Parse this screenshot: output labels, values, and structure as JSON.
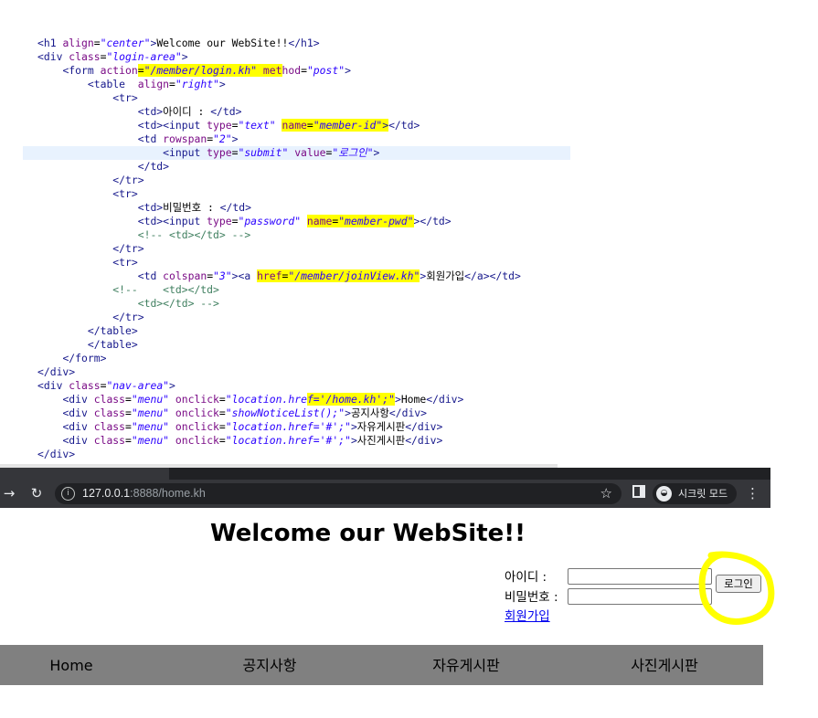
{
  "code": {
    "lines": [
      [
        {
          "c": "tag",
          "t": "<h1 "
        },
        {
          "c": "attr",
          "t": "align"
        },
        {
          "c": "txt",
          "t": "="
        },
        {
          "c": "str",
          "t": "\"center\""
        },
        {
          "c": "tag",
          "t": ">"
        },
        {
          "c": "txt",
          "t": "Welcome our WebSite!!"
        },
        {
          "c": "tag",
          "t": "</h1>"
        }
      ],
      [
        {
          "c": "tag",
          "t": "<div "
        },
        {
          "c": "attr",
          "t": "class"
        },
        {
          "c": "txt",
          "t": "="
        },
        {
          "c": "str",
          "t": "\"login-area\""
        },
        {
          "c": "tag",
          "t": ">"
        }
      ],
      [
        {
          "c": "txt",
          "t": "    "
        },
        {
          "c": "tag",
          "t": "<form "
        },
        {
          "c": "attr",
          "t": "action"
        },
        {
          "c": "txt hl",
          "t": "="
        },
        {
          "c": "str hl",
          "t": "\"/member/login.kh\""
        },
        {
          "c": "txt hl",
          "t": " "
        },
        {
          "c": "attr hl",
          "t": "met"
        },
        {
          "c": "attr",
          "t": "hod"
        },
        {
          "c": "txt",
          "t": "="
        },
        {
          "c": "str",
          "t": "\"post\""
        },
        {
          "c": "tag",
          "t": ">"
        }
      ],
      [
        {
          "c": "txt",
          "t": "        "
        },
        {
          "c": "tag",
          "t": "<table  "
        },
        {
          "c": "attr",
          "t": "align"
        },
        {
          "c": "txt",
          "t": "="
        },
        {
          "c": "str",
          "t": "\"right\""
        },
        {
          "c": "tag",
          "t": ">"
        }
      ],
      [
        {
          "c": "txt",
          "t": "            "
        },
        {
          "c": "tag",
          "t": "<tr>"
        }
      ],
      [
        {
          "c": "txt",
          "t": "                "
        },
        {
          "c": "tag",
          "t": "<td>"
        },
        {
          "c": "txt",
          "t": "아이디 : "
        },
        {
          "c": "tag",
          "t": "</td>"
        }
      ],
      [
        {
          "c": "txt",
          "t": "                "
        },
        {
          "c": "tag",
          "t": "<td><input "
        },
        {
          "c": "attr",
          "t": "type"
        },
        {
          "c": "txt",
          "t": "="
        },
        {
          "c": "str",
          "t": "\"text\" "
        },
        {
          "c": "attr hl",
          "t": "name"
        },
        {
          "c": "txt hl",
          "t": "="
        },
        {
          "c": "str hl",
          "t": "\"member-id\""
        },
        {
          "c": "tag hl",
          "t": ">"
        },
        {
          "c": "tag",
          "t": "</td>"
        }
      ],
      [
        {
          "c": "txt",
          "t": "                "
        },
        {
          "c": "tag",
          "t": "<td "
        },
        {
          "c": "attr",
          "t": "rowspan"
        },
        {
          "c": "txt",
          "t": "="
        },
        {
          "c": "str",
          "t": "\"2\""
        },
        {
          "c": "tag",
          "t": ">"
        }
      ],
      [
        {
          "c": "txt",
          "t": "                    "
        },
        {
          "c": "tag",
          "t": "<input "
        },
        {
          "c": "attr",
          "t": "type"
        },
        {
          "c": "txt",
          "t": "="
        },
        {
          "c": "str",
          "t": "\"submit\" "
        },
        {
          "c": "attr",
          "t": "value"
        },
        {
          "c": "txt",
          "t": "="
        },
        {
          "c": "str",
          "t": "\"로그인\""
        },
        {
          "c": "tag",
          "t": ">"
        }
      ],
      [
        {
          "c": "txt",
          "t": "                "
        },
        {
          "c": "tag",
          "t": "</td>"
        }
      ],
      [
        {
          "c": "txt",
          "t": "            "
        },
        {
          "c": "tag",
          "t": "</tr>"
        }
      ],
      [
        {
          "c": "txt",
          "t": "            "
        },
        {
          "c": "tag",
          "t": "<tr>"
        }
      ],
      [
        {
          "c": "txt",
          "t": "                "
        },
        {
          "c": "tag",
          "t": "<td>"
        },
        {
          "c": "txt",
          "t": "비밀번호 : "
        },
        {
          "c": "tag",
          "t": "</td>"
        }
      ],
      [
        {
          "c": "txt",
          "t": "                "
        },
        {
          "c": "tag",
          "t": "<td><input "
        },
        {
          "c": "attr",
          "t": "type"
        },
        {
          "c": "txt",
          "t": "="
        },
        {
          "c": "str",
          "t": "\"password\" "
        },
        {
          "c": "attr hl",
          "t": "name"
        },
        {
          "c": "txt hl",
          "t": "="
        },
        {
          "c": "str hl",
          "t": "\"member-pwd\""
        },
        {
          "c": "tag",
          "t": "></td>"
        }
      ],
      [
        {
          "c": "txt",
          "t": "                "
        },
        {
          "c": "cmt",
          "t": "<!-- <td></td> -->"
        }
      ],
      [
        {
          "c": "txt",
          "t": "            "
        },
        {
          "c": "tag",
          "t": "</tr>"
        }
      ],
      [
        {
          "c": "txt",
          "t": "            "
        },
        {
          "c": "tag",
          "t": "<tr>"
        }
      ],
      [
        {
          "c": "txt",
          "t": "                "
        },
        {
          "c": "tag",
          "t": "<td "
        },
        {
          "c": "attr",
          "t": "colspan"
        },
        {
          "c": "txt",
          "t": "="
        },
        {
          "c": "str",
          "t": "\"3\""
        },
        {
          "c": "tag",
          "t": "><a "
        },
        {
          "c": "attr hl",
          "t": "href"
        },
        {
          "c": "txt hl",
          "t": "="
        },
        {
          "c": "str hl",
          "t": "\"/member/joinView.kh\""
        },
        {
          "c": "tag",
          "t": ">"
        },
        {
          "c": "txt",
          "t": "회원가입"
        },
        {
          "c": "tag",
          "t": "</a></td>"
        }
      ],
      [
        {
          "c": "txt",
          "t": "            "
        },
        {
          "c": "cmt",
          "t": "<!--    <td></td>"
        }
      ],
      [
        {
          "c": "txt",
          "t": "                "
        },
        {
          "c": "cmt",
          "t": "<td></td> -->"
        }
      ],
      [
        {
          "c": "txt",
          "t": "            "
        },
        {
          "c": "tag",
          "t": "</tr>"
        }
      ],
      [
        {
          "c": "txt",
          "t": "        "
        },
        {
          "c": "tag",
          "t": "</table>"
        }
      ],
      [
        {
          "c": "txt",
          "t": "        "
        },
        {
          "c": "tag",
          "t": "</table>"
        }
      ],
      [
        {
          "c": "txt",
          "t": "    "
        },
        {
          "c": "tag",
          "t": "</form>"
        }
      ],
      [
        {
          "c": "tag",
          "t": "</div>"
        }
      ],
      [
        {
          "c": "tag",
          "t": "<div "
        },
        {
          "c": "attr",
          "t": "class"
        },
        {
          "c": "txt",
          "t": "="
        },
        {
          "c": "str",
          "t": "\"nav-area\""
        },
        {
          "c": "tag",
          "t": ">"
        }
      ],
      [
        {
          "c": "txt",
          "t": "    "
        },
        {
          "c": "tag",
          "t": "<div "
        },
        {
          "c": "attr",
          "t": "class"
        },
        {
          "c": "txt",
          "t": "="
        },
        {
          "c": "str",
          "t": "\"menu\" "
        },
        {
          "c": "attr",
          "t": "onclick"
        },
        {
          "c": "txt",
          "t": "="
        },
        {
          "c": "str",
          "t": "\"location.hre"
        },
        {
          "c": "str hl",
          "t": "f='/home.kh';\""
        },
        {
          "c": "tag",
          "t": ">"
        },
        {
          "c": "txt",
          "t": "Home"
        },
        {
          "c": "tag",
          "t": "</div>"
        }
      ],
      [
        {
          "c": "txt",
          "t": "    "
        },
        {
          "c": "tag",
          "t": "<div "
        },
        {
          "c": "attr",
          "t": "class"
        },
        {
          "c": "txt",
          "t": "="
        },
        {
          "c": "str",
          "t": "\"menu\" "
        },
        {
          "c": "attr",
          "t": "onclick"
        },
        {
          "c": "txt",
          "t": "="
        },
        {
          "c": "str",
          "t": "\"showNoticeList();\""
        },
        {
          "c": "tag",
          "t": ">"
        },
        {
          "c": "txt",
          "t": "공지사항"
        },
        {
          "c": "tag",
          "t": "</div>"
        }
      ],
      [
        {
          "c": "txt",
          "t": "    "
        },
        {
          "c": "tag",
          "t": "<div "
        },
        {
          "c": "attr",
          "t": "class"
        },
        {
          "c": "txt",
          "t": "="
        },
        {
          "c": "str",
          "t": "\"menu\" "
        },
        {
          "c": "attr",
          "t": "onclick"
        },
        {
          "c": "txt",
          "t": "="
        },
        {
          "c": "str",
          "t": "\"location.href='#';\""
        },
        {
          "c": "tag",
          "t": ">"
        },
        {
          "c": "txt",
          "t": "자유게시판"
        },
        {
          "c": "tag",
          "t": "</div>"
        }
      ],
      [
        {
          "c": "txt",
          "t": "    "
        },
        {
          "c": "tag",
          "t": "<div "
        },
        {
          "c": "attr",
          "t": "class"
        },
        {
          "c": "txt",
          "t": "="
        },
        {
          "c": "str",
          "t": "\"menu\" "
        },
        {
          "c": "attr",
          "t": "onclick"
        },
        {
          "c": "txt",
          "t": "="
        },
        {
          "c": "str",
          "t": "\"location.href='#';\""
        },
        {
          "c": "tag",
          "t": ">"
        },
        {
          "c": "txt",
          "t": "사진게시판"
        },
        {
          "c": "tag",
          "t": "</div>"
        }
      ],
      [
        {
          "c": "tag",
          "t": "</div>"
        }
      ]
    ],
    "current_line": 8
  },
  "browser": {
    "url_host": "127.0.0.1",
    "url_rest": ":8888/home.kh",
    "incognito_label": "시크릿 모드"
  },
  "page": {
    "title": "Welcome our WebSite!!",
    "id_label": "아이디 :",
    "pw_label": "비밀번호 :",
    "login_button": "로그인",
    "join_link": "회원가입",
    "menu": [
      "Home",
      "공지사항",
      "자유게시판",
      "사진게시판"
    ]
  },
  "colors": {
    "highlight": "#ffff00",
    "nav_bg": "#808080"
  }
}
